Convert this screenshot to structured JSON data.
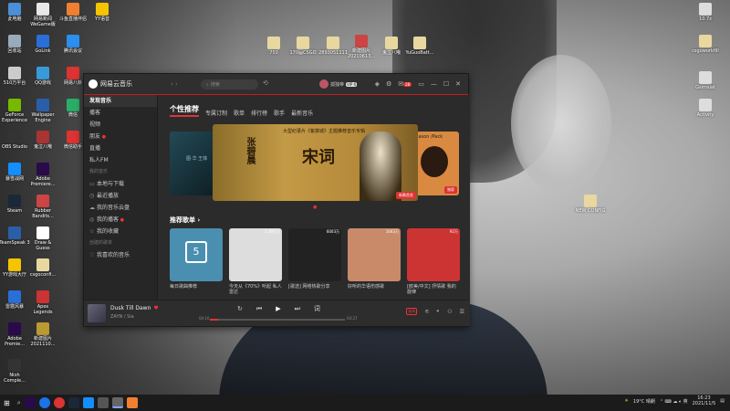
{
  "desktop_icons": [
    {
      "label": "此电脑",
      "color": "#4a8fd8"
    },
    {
      "label": "网易新闻 WeGame版",
      "color": "#e8e8e8"
    },
    {
      "label": "斗鱼直播伴侣",
      "color": "#f08030"
    },
    {
      "label": "YY语音",
      "color": "#f5c400"
    },
    {
      "label": "回收站",
      "color": "#9ab"
    },
    {
      "label": "GoLink",
      "color": "#2a6fd8"
    },
    {
      "label": "腾讯会议",
      "color": "#2a8ff0"
    },
    {
      "label": "510万平台",
      "color": "#ccc"
    },
    {
      "label": "QQ游戏",
      "color": "#3a9ad8"
    },
    {
      "label": "网易八卦",
      "color": "#d33"
    },
    {
      "label": "GeForce Experience",
      "color": "#76b900"
    },
    {
      "label": "Wallpaper Engine",
      "color": "#2a5fa8"
    },
    {
      "label": "微信",
      "color": "#2aae67"
    },
    {
      "label": "OBS Studio",
      "color": "#333"
    },
    {
      "label": "鬼泣八哦",
      "color": "#a33"
    },
    {
      "label": "微信助手",
      "color": "#d33"
    },
    {
      "label": "暴雪战网",
      "color": "#148eff"
    },
    {
      "label": "Adobe Premiere...",
      "color": "#2a0a4a"
    },
    {
      "label": "Steam",
      "color": "#1b2838"
    },
    {
      "label": "Rubber Bandits...",
      "color": "#c44"
    },
    {
      "label": "TeamSpeak 3",
      "color": "#2a5fa8"
    },
    {
      "label": "Draw & Guess",
      "color": "#fff"
    },
    {
      "label": "YY游戏大厅",
      "color": "#f5c400"
    },
    {
      "label": "csgoconfi...",
      "color": "#e8d8a0"
    },
    {
      "label": "雷霆风暴",
      "color": "#2a6fd8"
    },
    {
      "label": "Apex Legends",
      "color": "#c33"
    },
    {
      "label": "Adobe Premie...",
      "color": "#2a0a4a"
    },
    {
      "label": "新建图片 2021110...",
      "color": "#b93"
    },
    {
      "label": "Nioh Comple...",
      "color": "#333"
    },
    {
      "label": "750",
      "color": "#e8d8a0"
    },
    {
      "label": "170届CSGO",
      "color": "#e8d8a0"
    },
    {
      "label": "2893051111",
      "color": "#e8d8a0"
    },
    {
      "label": "新建图片 20210613...",
      "color": "#c44"
    },
    {
      "label": "鬼泣八哦",
      "color": "#e8d8a0"
    },
    {
      "label": "YuGuoBatt...",
      "color": "#e8d8a0"
    },
    {
      "label": "NEW CONFIG",
      "color": "#e8d8a0"
    },
    {
      "label": "10.7z",
      "color": "#ddd"
    },
    {
      "label": "csgoworkfill",
      "color": "#e8d8a0"
    },
    {
      "label": "Gsimsiat",
      "color": "#ddd"
    },
    {
      "label": "Activity",
      "color": "#ddd"
    }
  ],
  "app": {
    "title": "网易云音乐",
    "search_placeholder": "搜索",
    "username": "孤独帝",
    "vip": "VIP 6",
    "mail_badge": "28",
    "sidebar": [
      {
        "label": "发现音乐",
        "type": "item",
        "active": true
      },
      {
        "label": "播客",
        "type": "item"
      },
      {
        "label": "视频",
        "type": "item"
      },
      {
        "label": "朋友",
        "type": "item",
        "dot": true
      },
      {
        "label": "直播",
        "type": "item"
      },
      {
        "label": "私人FM",
        "type": "item"
      },
      {
        "label": "我的音乐",
        "type": "head"
      },
      {
        "label": "本地与下载",
        "type": "item",
        "icon": "▭"
      },
      {
        "label": "最近播放",
        "type": "item",
        "icon": "◷"
      },
      {
        "label": "我的音乐云盘",
        "type": "item",
        "icon": "☁"
      },
      {
        "label": "我的播客",
        "type": "item",
        "icon": "◎",
        "dot": true
      },
      {
        "label": "我的收藏",
        "type": "item",
        "icon": "☆"
      },
      {
        "label": "创建的歌单",
        "type": "head"
      },
      {
        "label": "我喜欢的音乐",
        "type": "item",
        "icon": "♡"
      }
    ],
    "tabs": [
      "个性推荐",
      "专属订制",
      "歌单",
      "排行榜",
      "歌手",
      "最新音乐"
    ],
    "banner": {
      "name": "张碧晨",
      "title": "大型纪录片《紫禁城》主题推荐音乐专辑",
      "big": "宋词",
      "tag_main": "新歌首发",
      "tag_right": "独家",
      "right_text": "Jason /Pack",
      "left_text": "图·华 王菲"
    },
    "section_title": "推荐歌单",
    "playlists": [
      {
        "title": "每日歌曲推荐",
        "plays": "",
        "cover": "#4a8fb0",
        "date": "5"
      },
      {
        "title": "今天从《70%》听起 私人雷达",
        "plays": "1.36亿万",
        "cover": "#ddd"
      },
      {
        "title": "[歌选] 网络热歌分享",
        "plays": "6003万",
        "cover": "#222"
      },
      {
        "title": "好听的华语伤感歌",
        "plays": "1043万",
        "cover": "#c98a6a"
      },
      {
        "title": "[欧美/中文] 抒情歌 我的旋律",
        "plays": "92万",
        "cover": "#c33"
      }
    ],
    "player": {
      "song": "Dusk Till Dawn",
      "artist": "ZAYN / Sia",
      "current": "00:16",
      "total": "04:27",
      "progress": 0.06,
      "hq": "极高"
    }
  },
  "taskbar": {
    "weather": "19°C 晴朗",
    "time": "16:23",
    "date": "2021/11/5"
  }
}
